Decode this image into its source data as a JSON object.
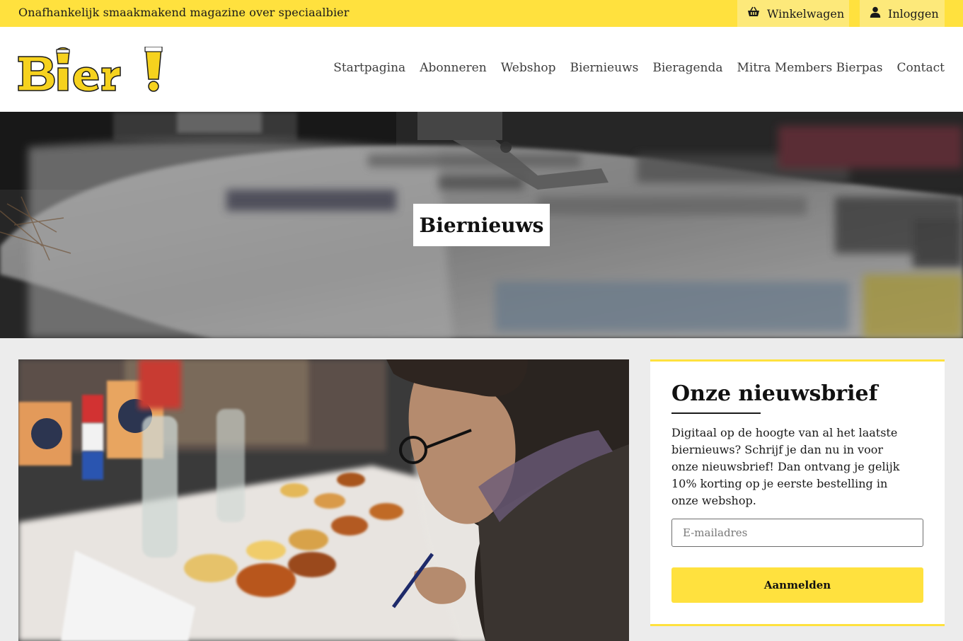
{
  "topbar": {
    "tagline": "Onafhankelijk smaakmakend magazine over speciaalbier",
    "cart_label": "Winkelwagen",
    "login_label": "Inloggen"
  },
  "header": {
    "logo_text": "Bier!",
    "nav": [
      {
        "label": "Startpagina"
      },
      {
        "label": "Abonneren"
      },
      {
        "label": "Webshop"
      },
      {
        "label": "Biernieuws"
      },
      {
        "label": "Bieragenda"
      },
      {
        "label": "Mitra Members Bierpas"
      },
      {
        "label": "Contact"
      }
    ]
  },
  "hero": {
    "title": "Biernieuws"
  },
  "newsletter": {
    "title": "Onze nieuwsbrief",
    "text": "Digitaal op de hoogte van al het laatste biernieuws? Schrijf je dan nu in voor onze nieuwsbrief! Dan ontvang je gelijk 10% korting op je eerste bestelling in onze webshop.",
    "email_placeholder": "E-mailadres",
    "submit_label": "Aanmelden"
  },
  "colors": {
    "brand_yellow": "#ffe13e",
    "light_yellow": "#fde97a",
    "background": "#ececec"
  }
}
